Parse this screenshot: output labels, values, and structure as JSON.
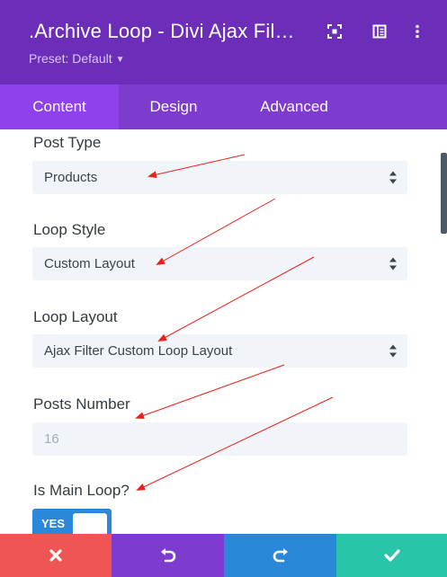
{
  "header": {
    "title": ".Archive Loop - Divi Ajax Fil…",
    "preset": "Preset: Default",
    "icons": [
      "fullscreen-icon",
      "split-view-icon",
      "more-options-icon"
    ]
  },
  "tabs": [
    {
      "label": "Content",
      "active": true
    },
    {
      "label": "Design",
      "active": false
    },
    {
      "label": "Advanced",
      "active": false
    }
  ],
  "fields": {
    "post_type": {
      "label": "Post Type",
      "value": "Products"
    },
    "loop_style": {
      "label": "Loop Style",
      "value": "Custom Layout"
    },
    "loop_layout": {
      "label": "Loop Layout",
      "value": "Ajax Filter Custom Loop Layout"
    },
    "posts_number": {
      "label": "Posts Number",
      "placeholder": "16"
    },
    "is_main_loop": {
      "label": "Is Main Loop?",
      "toggle_label": "YES",
      "on": true
    }
  },
  "footer": {
    "buttons": [
      "close-icon",
      "undo-icon",
      "redo-icon",
      "save-check-icon"
    ],
    "colors": {
      "close": "#ef5555",
      "undo": "#7e3bd0",
      "redo": "#2b87da",
      "save": "#29c4a9"
    }
  },
  "colors": {
    "header": "#6c2eb9",
    "tabs": "#7e3bd0",
    "active_tab": "#8f42ec",
    "annotation_arrow": "#e8221b"
  }
}
